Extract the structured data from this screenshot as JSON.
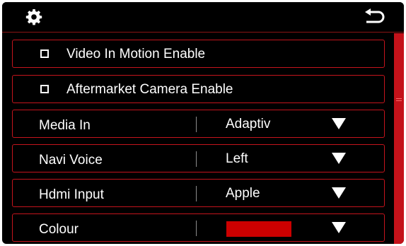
{
  "header": {
    "settings_icon": "gear-icon",
    "back_icon": "back-arrow-icon"
  },
  "settings": {
    "video_in_motion": {
      "label": "Video In Motion Enable",
      "checked": false
    },
    "aftermarket_camera": {
      "label": "Aftermarket Camera Enable",
      "checked": false
    },
    "media_in": {
      "label": "Media In",
      "value": "Adaptiv"
    },
    "navi_voice": {
      "label": "Navi Voice",
      "value": "Left"
    },
    "hdmi_input": {
      "label": "Hdmi Input",
      "value": "Apple"
    },
    "colour": {
      "label": "Colour",
      "value_color": "#cc0000"
    }
  },
  "colors": {
    "accent": "#c4141c",
    "background": "#000000",
    "text": "#ffffff"
  }
}
